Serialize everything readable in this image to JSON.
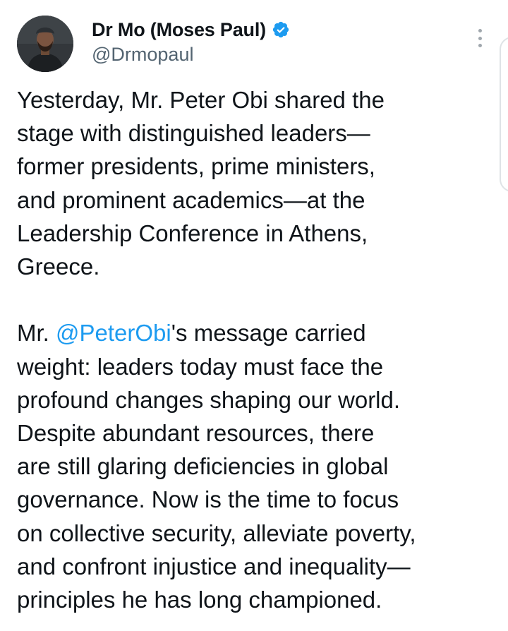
{
  "tweet": {
    "author": {
      "display_name": "Dr Mo (Moses Paul)",
      "handle": "@Drmopaul",
      "verified": true,
      "verified_color": "#1d9bf0"
    },
    "paragraph1": [
      "Yesterday, Mr. Peter Obi shared the",
      "stage with distinguished leaders—",
      "former presidents, prime ministers,",
      "and prominent academics—at the",
      "Leadership Conference in Athens,",
      "Greece."
    ],
    "paragraph2": {
      "first_line_prefix": "Mr. ",
      "mention": "@PeterObi",
      "first_line_suffix": "'s message carried",
      "lines": [
        "weight: leaders today must face the",
        "profound changes shaping our world.",
        "Despite abundant resources, there",
        "are still glaring deficiencies in global",
        "governance. Now is the time to focus",
        "on collective security, alleviate poverty,",
        "and confront injustice and inequality—",
        "principles he has long championed."
      ]
    },
    "mention_color": "#1d9bf0",
    "icons": {
      "verified": "verified-badge-icon",
      "more": "more-options-icon"
    }
  }
}
